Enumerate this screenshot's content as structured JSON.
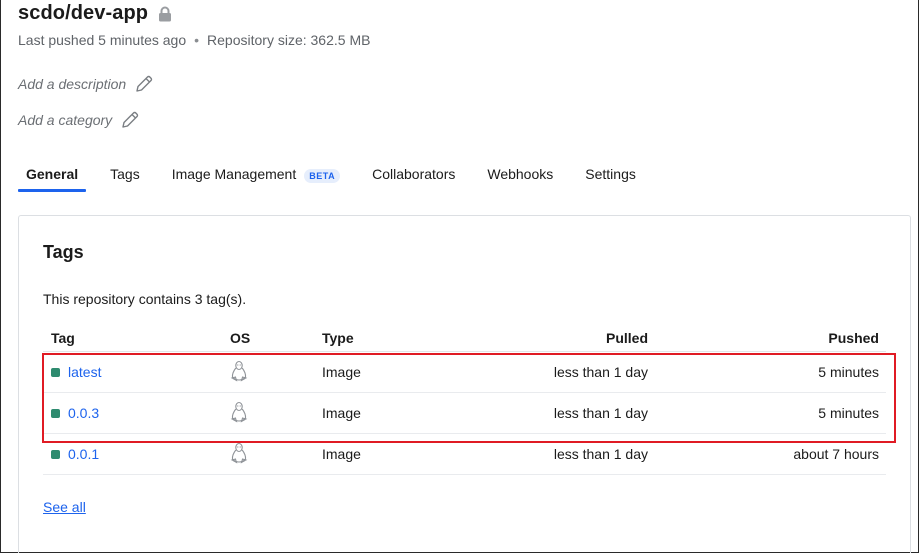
{
  "repo": {
    "title": "scdo/dev-app",
    "last_pushed": "Last pushed 5 minutes ago",
    "separator": "•",
    "size": "Repository size: 362.5 MB",
    "add_description": "Add a description",
    "add_category": "Add a category"
  },
  "tabs": [
    {
      "label": "General",
      "active": true
    },
    {
      "label": "Tags"
    },
    {
      "label": "Image Management",
      "badge": "BETA"
    },
    {
      "label": "Collaborators"
    },
    {
      "label": "Webhooks"
    },
    {
      "label": "Settings"
    }
  ],
  "tags_card": {
    "title": "Tags",
    "subtitle": "This repository contains 3 tag(s).",
    "columns": {
      "tag": "Tag",
      "os": "OS",
      "type": "Type",
      "pulled": "Pulled",
      "pushed": "Pushed"
    },
    "rows": [
      {
        "tag": "latest",
        "os": "linux-icon",
        "type": "Image",
        "pulled": "less than 1 day",
        "pushed": "5 minutes"
      },
      {
        "tag": "0.0.3",
        "os": "linux-icon",
        "type": "Image",
        "pulled": "less than 1 day",
        "pushed": "5 minutes"
      },
      {
        "tag": "0.0.1",
        "os": "linux-icon",
        "type": "Image",
        "pulled": "less than 1 day",
        "pushed": "about 7 hours"
      }
    ],
    "see_all": "See all"
  },
  "colors": {
    "accent": "#1d63ed",
    "status": "#2e8b6f",
    "highlight": "#e01b24"
  }
}
